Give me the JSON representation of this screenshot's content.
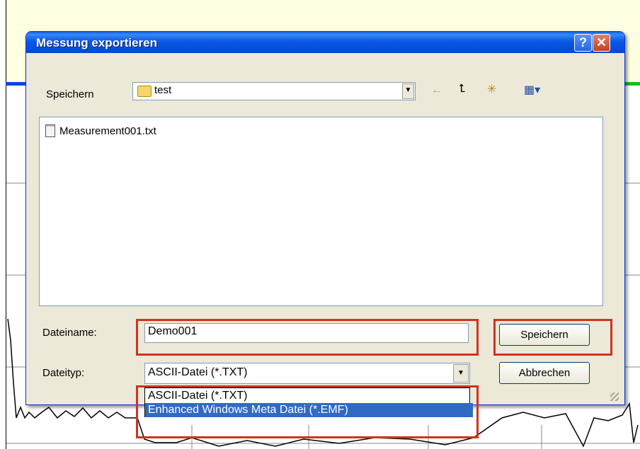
{
  "dialog": {
    "title": "Messung exportieren",
    "help_glyph": "?",
    "close_glyph": "✕"
  },
  "save_in": {
    "label": "Speichern",
    "folder": "test"
  },
  "toolbar": {
    "back_icon": "←",
    "up_icon": "⮤",
    "new_folder_icon": "✳",
    "view_icon": "▦▾"
  },
  "files": [
    "Measurement001.txt"
  ],
  "filename": {
    "label": "Dateiname:",
    "value": "Demo001"
  },
  "filetype": {
    "label": "Dateityp:",
    "selected": "ASCII-Datei (*.TXT)",
    "options": [
      "ASCII-Datei (*.TXT)",
      "Enhanced Windows Meta Datei (*.EMF)"
    ]
  },
  "buttons": {
    "save": "Speichern",
    "cancel": "Abbrechen"
  },
  "colors": {
    "titlebar": "#0a58e4",
    "highlight": "#d0331f",
    "selection": "#316ac5"
  }
}
